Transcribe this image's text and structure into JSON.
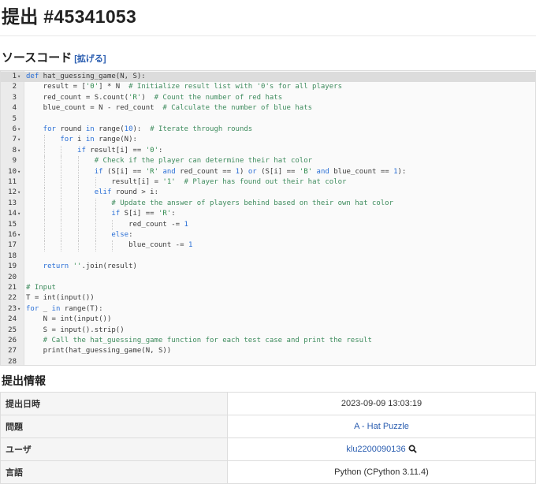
{
  "page": {
    "title": "提出 #45341053"
  },
  "source": {
    "heading": "ソースコード",
    "expand_label": "[拡げる]",
    "lines": [
      {
        "n": "1",
        "fold": "▾",
        "indent": 0,
        "html": "<span class=\"kw\">def</span> hat_guessing_game(N, S):"
      },
      {
        "n": "2",
        "fold": "",
        "indent": 1,
        "html": "result = [<span class=\"str\">'0'</span>] * N  <span class=\"com\"># Initialize result list with '0's for all players</span>"
      },
      {
        "n": "3",
        "fold": "",
        "indent": 1,
        "html": "red_count = S.count(<span class=\"str\">'R'</span>)  <span class=\"com\"># Count the number of red hats</span>"
      },
      {
        "n": "4",
        "fold": "",
        "indent": 1,
        "html": "blue_count = N - red_count  <span class=\"com\"># Calculate the number of blue hats</span>"
      },
      {
        "n": "5",
        "fold": "",
        "indent": 0,
        "html": ""
      },
      {
        "n": "6",
        "fold": "▾",
        "indent": 1,
        "html": "<span class=\"kw\">for</span> round <span class=\"kw\">in</span> range(<span class=\"num\">10</span>):  <span class=\"com\"># Iterate through rounds</span>"
      },
      {
        "n": "7",
        "fold": "▾",
        "indent": 2,
        "html": "<span class=\"kw\">for</span> i <span class=\"kw\">in</span> range(N):"
      },
      {
        "n": "8",
        "fold": "▾",
        "indent": 3,
        "html": "<span class=\"kw\">if</span> result[i] == <span class=\"str\">'0'</span>:"
      },
      {
        "n": "9",
        "fold": "",
        "indent": 4,
        "html": "<span class=\"com\"># Check if the player can determine their hat color</span>"
      },
      {
        "n": "10",
        "fold": "▾",
        "indent": 4,
        "html": "<span class=\"kw\">if</span> (S[i] == <span class=\"str\">'R'</span> <span class=\"kw\">and</span> red_count == <span class=\"num\">1</span>) <span class=\"kw\">or</span> (S[i] == <span class=\"str\">'B'</span> <span class=\"kw\">and</span> blue_count == <span class=\"num\">1</span>):"
      },
      {
        "n": "11",
        "fold": "",
        "indent": 5,
        "html": "result[i] = <span class=\"str\">'1'</span>  <span class=\"com\"># Player has found out their hat color</span>"
      },
      {
        "n": "12",
        "fold": "▾",
        "indent": 4,
        "html": "<span class=\"kw\">elif</span> round &gt; i:"
      },
      {
        "n": "13",
        "fold": "",
        "indent": 5,
        "html": "<span class=\"com\"># Update the answer of players behind based on their own hat color</span>"
      },
      {
        "n": "14",
        "fold": "▾",
        "indent": 5,
        "html": "<span class=\"kw\">if</span> S[i] == <span class=\"str\">'R'</span>:"
      },
      {
        "n": "15",
        "fold": "",
        "indent": 6,
        "html": "red_count -= <span class=\"num\">1</span>"
      },
      {
        "n": "16",
        "fold": "▾",
        "indent": 5,
        "html": "<span class=\"kw\">else</span>:"
      },
      {
        "n": "17",
        "fold": "",
        "indent": 6,
        "html": "blue_count -= <span class=\"num\">1</span>"
      },
      {
        "n": "18",
        "fold": "",
        "indent": 0,
        "html": ""
      },
      {
        "n": "19",
        "fold": "",
        "indent": 1,
        "html": "<span class=\"kw\">return</span> <span class=\"str\">''</span>.join(result)"
      },
      {
        "n": "20",
        "fold": "",
        "indent": 0,
        "html": ""
      },
      {
        "n": "21",
        "fold": "",
        "indent": 0,
        "html": "<span class=\"com\"># Input</span>"
      },
      {
        "n": "22",
        "fold": "",
        "indent": 0,
        "html": "T = int(input())"
      },
      {
        "n": "23",
        "fold": "▾",
        "indent": 0,
        "html": "<span class=\"kw\">for</span> _ <span class=\"kw\">in</span> range(T):"
      },
      {
        "n": "24",
        "fold": "",
        "indent": 1,
        "html": "N = int(input())"
      },
      {
        "n": "25",
        "fold": "",
        "indent": 1,
        "html": "S = input().strip()"
      },
      {
        "n": "26",
        "fold": "",
        "indent": 1,
        "html": "<span class=\"com\"># Call the hat_guessing_game function for each test case and print the result</span>"
      },
      {
        "n": "27",
        "fold": "",
        "indent": 1,
        "html": "print(hat_guessing_game(N, S))"
      },
      {
        "n": "28",
        "fold": "",
        "indent": 0,
        "html": ""
      }
    ]
  },
  "info": {
    "heading": "提出情報",
    "rows": [
      {
        "key": "提出日時",
        "value": "2023-09-09 13:03:19",
        "link": false
      },
      {
        "key": "問題",
        "value": "A - Hat Puzzle",
        "link": true
      },
      {
        "key": "ユーザ",
        "value": "klu2200090136",
        "link": true,
        "icon": "search-icon"
      },
      {
        "key": "言語",
        "value": "Python (CPython 3.11.4)",
        "link": false
      }
    ]
  }
}
